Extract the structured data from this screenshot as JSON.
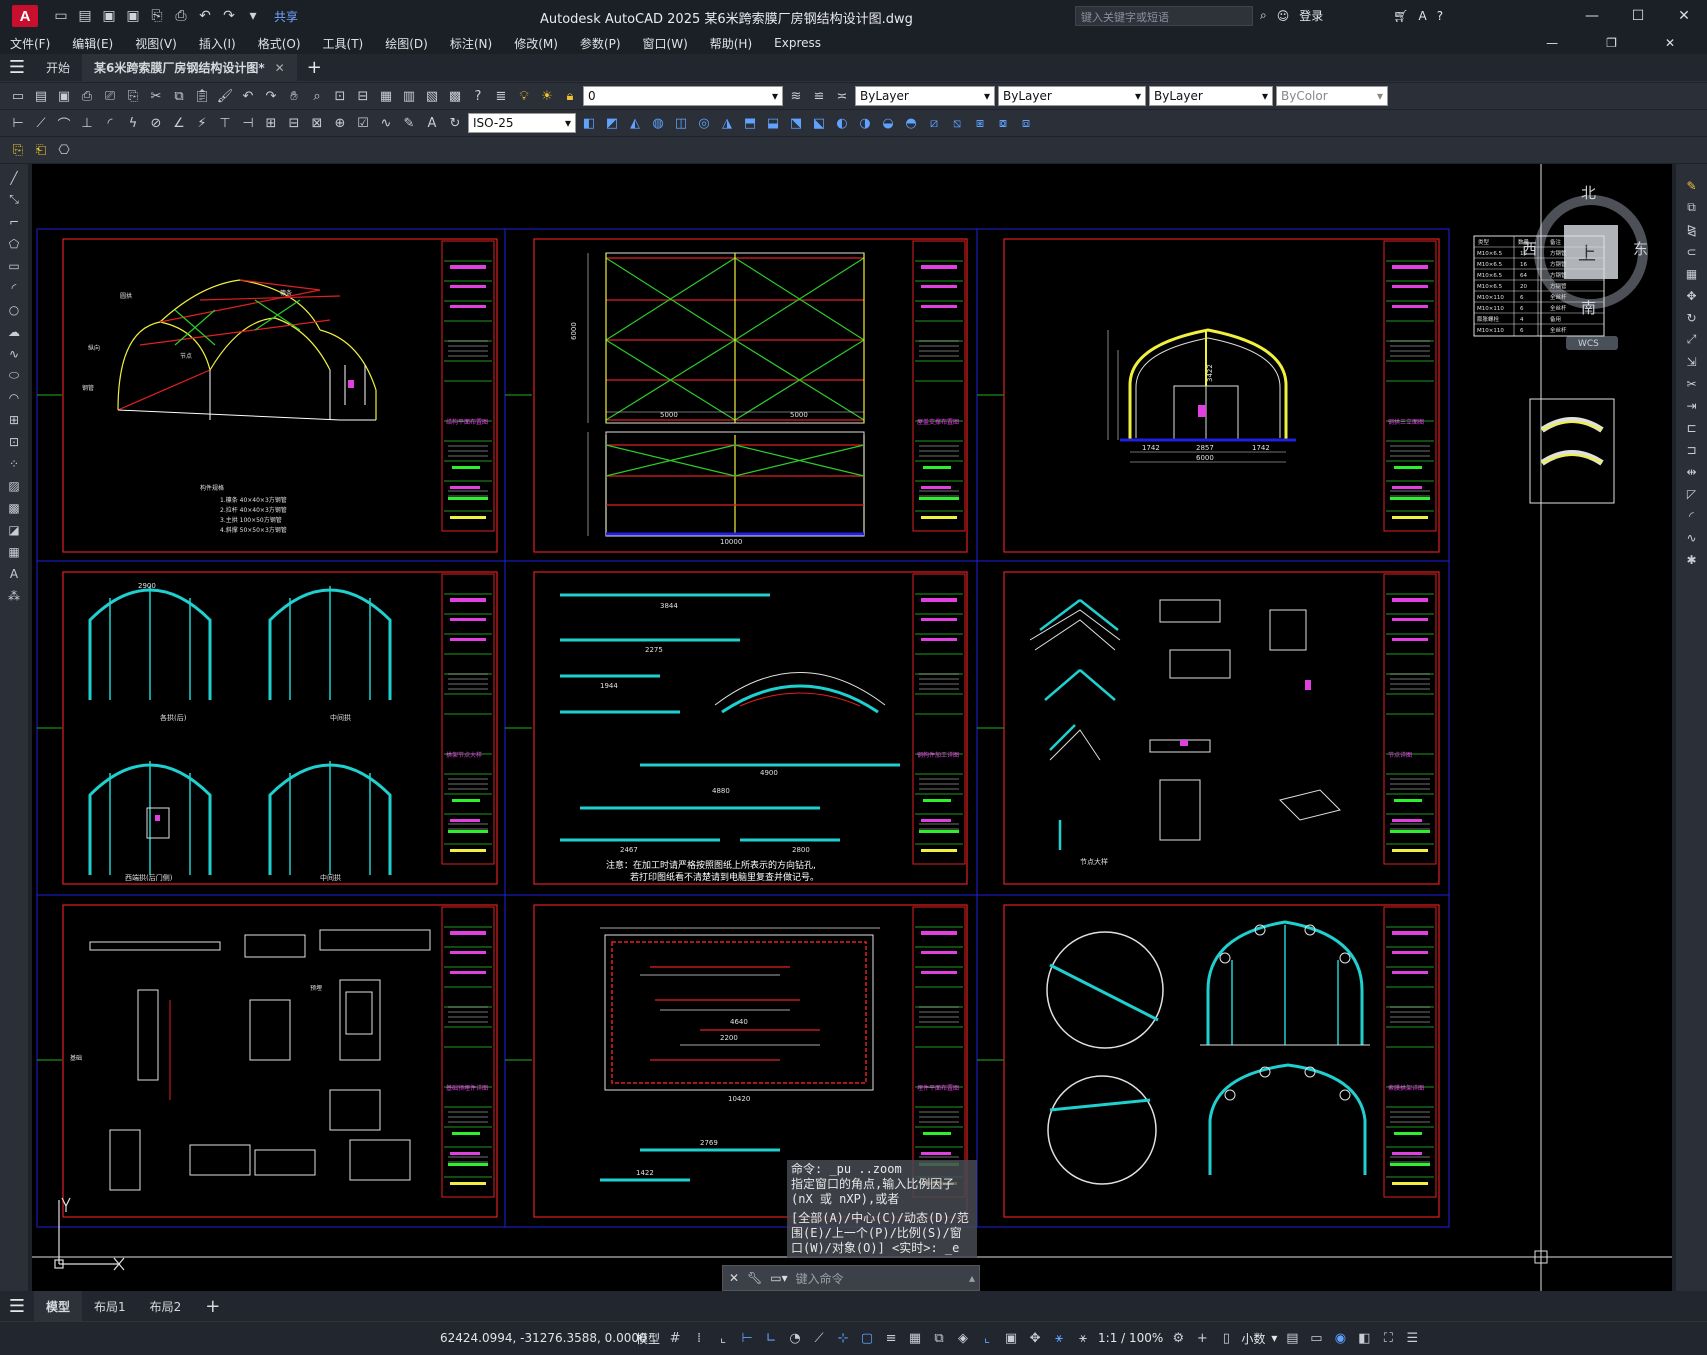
{
  "app": {
    "logo": "A",
    "title": "Autodesk AutoCAD 2025    某6米跨索膜厂房钢结构设计图.dwg"
  },
  "titlebar": {
    "share": "共享",
    "search_placeholder": "键入关键字或短语",
    "login": "登录"
  },
  "menu": [
    "文件(F)",
    "编辑(E)",
    "视图(V)",
    "插入(I)",
    "格式(O)",
    "工具(T)",
    "绘图(D)",
    "标注(N)",
    "修改(M)",
    "参数(P)",
    "窗口(W)",
    "帮助(H)",
    "Express"
  ],
  "doc_tabs": {
    "start": "开始",
    "active": "某6米跨索膜厂房钢结构设计图*"
  },
  "props": {
    "layer": "0",
    "color": "ByLayer",
    "linetype": "ByLayer",
    "lineweight": "ByLayer",
    "plotstyle": "ByColor",
    "dimstyle": "ISO-25"
  },
  "viewcube": {
    "north": "北",
    "south": "南",
    "east": "东",
    "west": "西",
    "top": "上",
    "wcs": "WCS"
  },
  "drawing": {
    "dims": {
      "d2900": "2900",
      "d3844": "3844",
      "d2275": "2275",
      "d1944": "1944",
      "d4880": "4880",
      "d4900": "4900",
      "d2467": "2467",
      "d2800": "2800",
      "d5000": "5000",
      "d10000": "10000",
      "d6000": "6000",
      "d2857": "2857",
      "d1742": "1742",
      "d3422": "3422",
      "d2200": "2200",
      "d4640": "4640",
      "d2769": "2769",
      "d1422": "1422",
      "d10420": "10420"
    },
    "notes": {
      "n1": "注意：在加工时请严格按照图纸上所表示的方向钻孔,",
      "n2": "若打印图纸看不清楚请到电脑里复查并做记号。"
    },
    "labels": {
      "l1": "西端拱(后门侧)",
      "l2": "中间拱",
      "l3": "节点大样",
      "l4": "各拱(后)",
      "l5": "中间拱"
    },
    "side_labels": {
      "s1": "结构平面布置图",
      "s2": "屋盖支撑布置图",
      "s3": "钢拱三立面图",
      "s4": "拱架节点大样",
      "s5": "钢构件加工详图",
      "s6": "节点详图",
      "s7": "基础预埋件详图",
      "s8": "埋件平面布置图",
      "s9": "索膜拱架详图"
    },
    "table_header": [
      "类型",
      "数量",
      "备注"
    ],
    "table_rows": [
      [
        "M10×6.5",
        "16",
        "方钢管"
      ],
      [
        "M10×6.5",
        "16",
        "方钢管"
      ],
      [
        "M10×6.5",
        "64",
        "方钢管"
      ],
      [
        "M10×6.5",
        "20",
        "方钢管"
      ],
      [
        "M10×110",
        "6",
        "全丝杆"
      ],
      [
        "M10×110",
        "6",
        "全丝杆"
      ],
      [
        "膨胀螺栓",
        "4",
        "备用"
      ],
      [
        "M10×110",
        "6",
        "全丝杆"
      ]
    ]
  },
  "cmd": {
    "history": [
      "命令: _pu ..zoom",
      "指定窗口的角点,输入比例因子(nX 或 nXP),或者",
      "[全部(A)/中心(C)/动态(D)/范围(E)/上一个(P)/比例(S)/窗口(W)/对象(O)] <实时>: _e"
    ],
    "placeholder": "键入命令"
  },
  "layout_tabs": [
    "模型",
    "布局1",
    "布局2"
  ],
  "status": {
    "coords": "62424.0994, -31276.3588, 0.0000",
    "model": "模型",
    "scale": "1:1 / 100%",
    "units": "小数"
  }
}
